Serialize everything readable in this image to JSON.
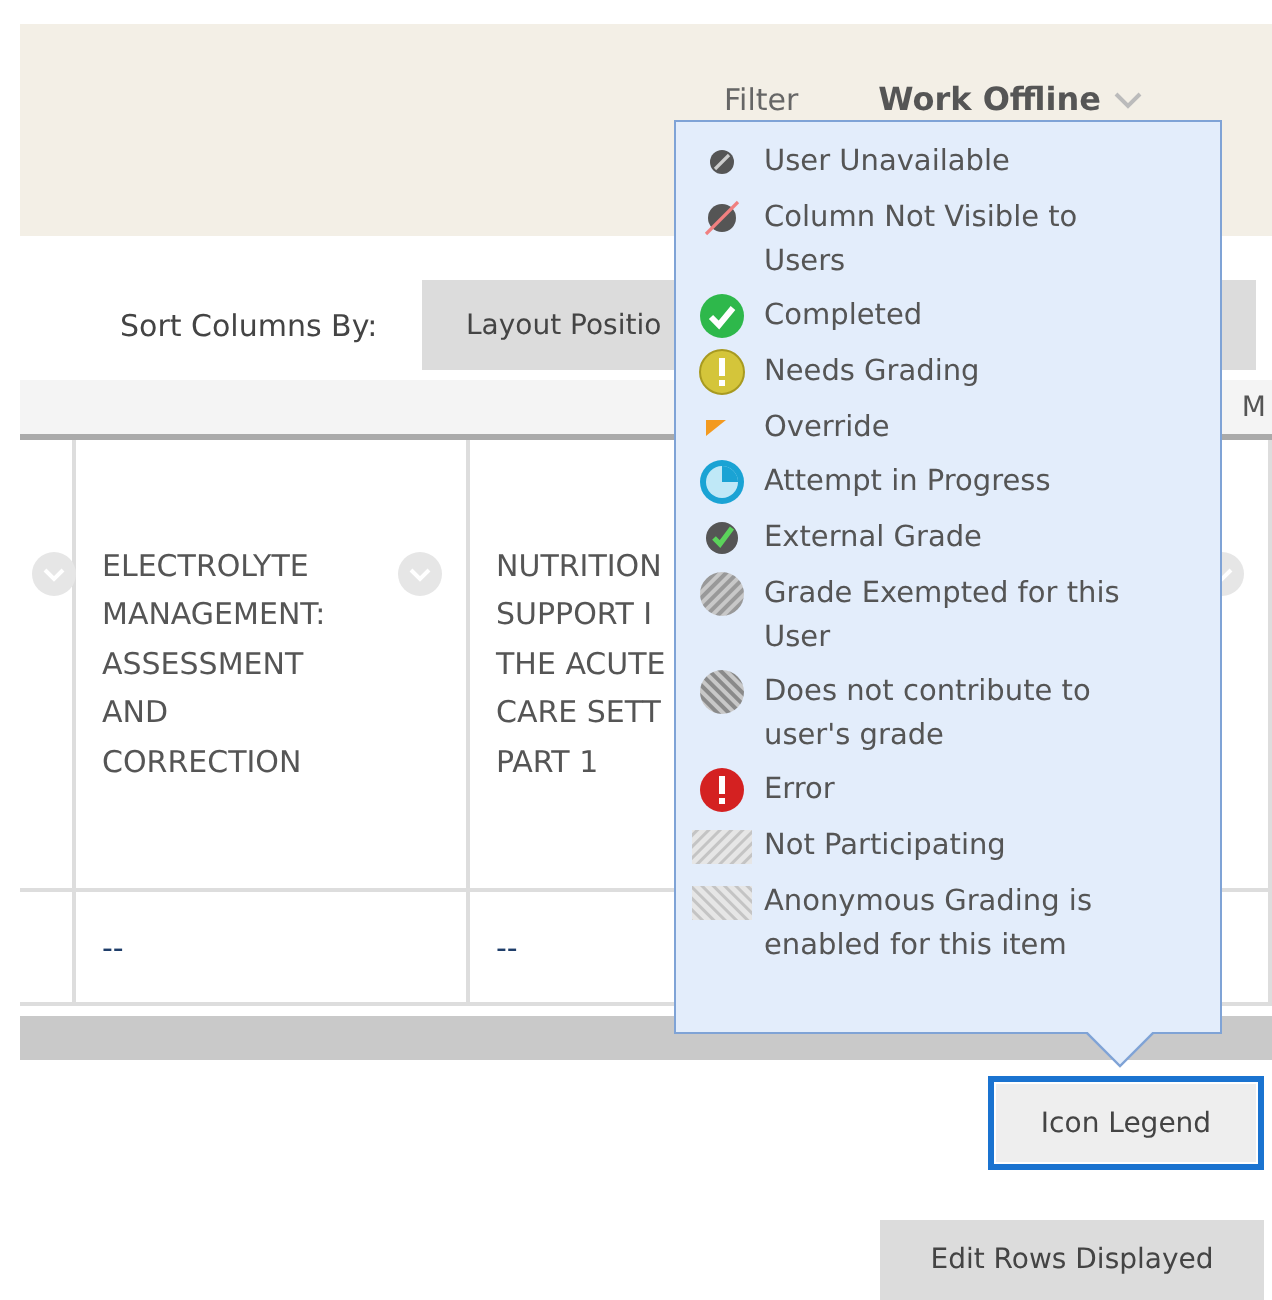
{
  "top_bar": {
    "filter": "Filter",
    "work_offline": "Work Offline"
  },
  "sort": {
    "label": "Sort Columns By:",
    "value": "Layout Positio"
  },
  "header_strip": {
    "column_3": "M"
  },
  "table": {
    "columns": [
      {},
      {
        "lines": [
          "ELECTROLYTE",
          "MANAGEMENT:",
          "ASSESSMENT",
          "AND",
          "CORRECTION"
        ]
      },
      {
        "lines": [
          "NUTRITION",
          "SUPPORT I",
          "THE ACUTE",
          "CARE SETT",
          "PART 1"
        ]
      }
    ],
    "rows": [
      [
        "",
        "--",
        "--"
      ]
    ]
  },
  "legend": {
    "items": [
      {
        "kind": "unavailable",
        "label": "User Unavailable"
      },
      {
        "kind": "hidden",
        "label": "Column Not Visible to Users"
      },
      {
        "kind": "completed",
        "label": "Completed"
      },
      {
        "kind": "needs_grading",
        "label": "Needs Grading"
      },
      {
        "kind": "override",
        "label": "Override"
      },
      {
        "kind": "in_progress",
        "label": "Attempt in Progress"
      },
      {
        "kind": "external",
        "label": "External Grade"
      },
      {
        "kind": "exempted",
        "label": "Grade Exempted for this User"
      },
      {
        "kind": "not_counted",
        "label": "Does not contribute to user's grade"
      },
      {
        "kind": "error",
        "label": "Error"
      },
      {
        "kind": "not_participating",
        "label": "Not Participating"
      },
      {
        "kind": "anonymous",
        "label": "Anonymous Grading is enabled for this item"
      }
    ]
  },
  "buttons": {
    "icon_legend": "Icon Legend",
    "edit_rows": "Edit Rows Displayed"
  }
}
